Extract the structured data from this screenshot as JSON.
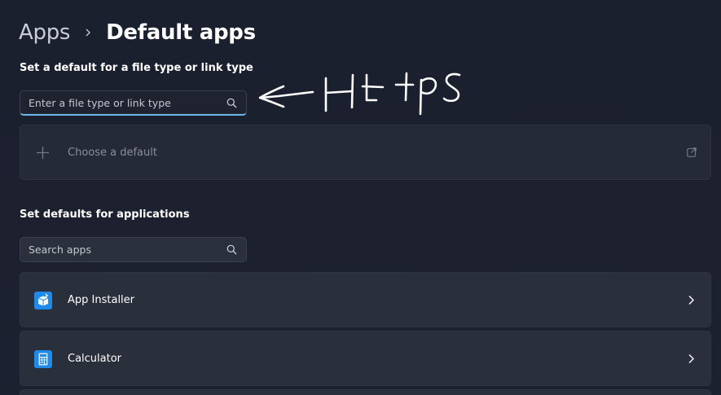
{
  "breadcrumb": {
    "parent": "Apps",
    "current": "Default apps"
  },
  "file_type_section": {
    "title": "Set a default for a file type or link type",
    "search_placeholder": "Enter a file type or link type",
    "choose_default_label": "Choose a default"
  },
  "applications_section": {
    "title": "Set defaults for applications",
    "search_placeholder": "Search apps",
    "apps": [
      {
        "label": "App Installer",
        "icon": "app-installer-icon"
      },
      {
        "label": "Calculator",
        "icon": "calculator-icon"
      }
    ]
  },
  "annotation": {
    "text": "Https",
    "description": "handwritten arrow pointing to file type search box"
  },
  "colors": {
    "background": "#1c2130",
    "card": "#2a2f3c",
    "accent": "#6fb7ea",
    "app_icon_blue": "#1f8ae8"
  }
}
